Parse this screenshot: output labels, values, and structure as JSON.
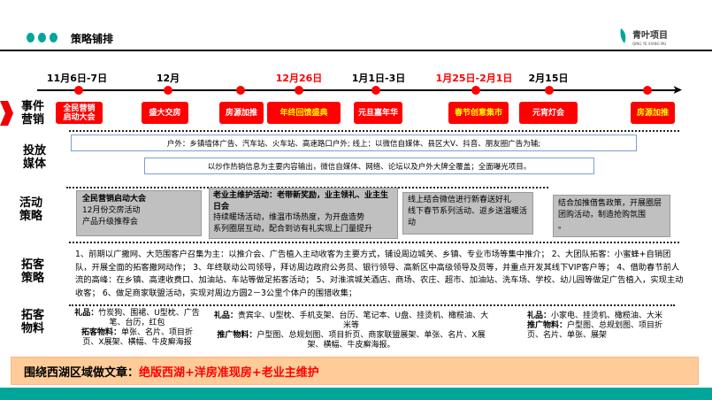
{
  "header": {
    "title": "策略铺排",
    "logo_text": "青叶项目",
    "logo_sub": "QING YE XIANG MU"
  },
  "timeline": {
    "dates": [
      {
        "label": "11月6日-7日"
      },
      {
        "label": "12月"
      },
      {
        "label": "12月26日"
      },
      {
        "label": "1月1日-3日"
      },
      {
        "label": "1月25日-2月1日"
      },
      {
        "label": "2月15日"
      }
    ],
    "events": [
      "全民营销启动大会",
      "盛大交房",
      "房源加推",
      "年终回馈盛典",
      "元旦嘉年华",
      "春节创意集市",
      "元宵灯会",
      "房源加推"
    ]
  },
  "sections": {
    "event": "事件营销",
    "media": "投放媒体",
    "activity": "活动策略",
    "acquisition": "拓客策略",
    "materials": "拓客物料"
  },
  "media": {
    "line1": "户外：乡镇墙体广告、汽车站、火车站、高速路口户外;        线上：以微信自媒体、县区大V、抖音、朋友圈广告为辅;",
    "line2": "以炒作热销信息为主要内容输出，微信自媒体、网络、论坛以及户外大牌全覆盖；全面曝光项目。"
  },
  "activities": {
    "a": {
      "title": "全民营销启动大会",
      "l1": "12月份交房活动",
      "l2": "产品升级推荐会"
    },
    "b": {
      "title": "老业主维护活动：老带新奖励，业主领礼、业主生日会",
      "l1": "持续暖场活动，维温市场热度，为开盘造势",
      "l2": "系列圈层互动，配合到访有礼实现上门量提升"
    },
    "c": {
      "l1": "线上结合微信进行新春送好礼",
      "l2": "线下春节系列活动、返乡送温暖活动"
    },
    "d": {
      "l1": "结合加推借售政策，开展圈层团购活动，制造抢购氛围",
      "l2": "。"
    }
  },
  "acquisition": {
    "text": "1、前期以广撒网、大范围客户召集为主：以推介会、广告植入主动收客为主要方式，铺设周边城关、乡镇、专业市场等集中推介； 2、大团队拓客：小蜜蜂+自销团队，开展全面的拓客撒网动作； 3、年终联动公司领导，拜访周边政府公务员、银行领导、高新区中高级领导及员等，并重点开发其线下VIP客户等； 4、借助春节前人流的高峰：在乡镇、高速收费口、加油站、车站等做足拓客活动； 5、对淮滨城关酒店、商场、农庄、超市、加油站、洗车场、学校、幼儿园等做足广告植入，实现主动收客； 6、做足商家联盟活动，实现对周边方圆2－3公里个体户的围猎收集；"
  },
  "materials": {
    "c1": {
      "gift_label": "礼品：",
      "gift": "竹炭狗、围裙、U型枕、广告笔、台历，红包",
      "mat_label": "拓客物料：",
      "mat": "单张、名片、项目折页、X展架、横幅、牛皮癣海报"
    },
    "c2": {
      "gift_label": "礼品：",
      "gift": "贵宾伞、U型枕、手机支架、台历、笔记本、U盘、挂烫机、橄榄油、大米等",
      "mat_label": "推广物料：",
      "mat": "户型图、总规划图、项目折页、商家联盟展架、单张、名片、X展架、横幅、牛皮癣海报。"
    },
    "c3": {
      "gift_label": "礼品：",
      "gift": "小家电、挂烫机、橄榄油、大米",
      "mat_label": "推广物料：",
      "mat": "户型图、总规划图、项目折页、名片、单张、展架"
    }
  },
  "banner": {
    "prefix": "围绕西湖区域做文章：",
    "highlight": "绝版西湖+洋房准现房+老业主维护"
  },
  "colors": {
    "accent": "#00a699",
    "red": "#ff0000",
    "banner": "#ffcc99",
    "gray": "#c0c0c0"
  }
}
